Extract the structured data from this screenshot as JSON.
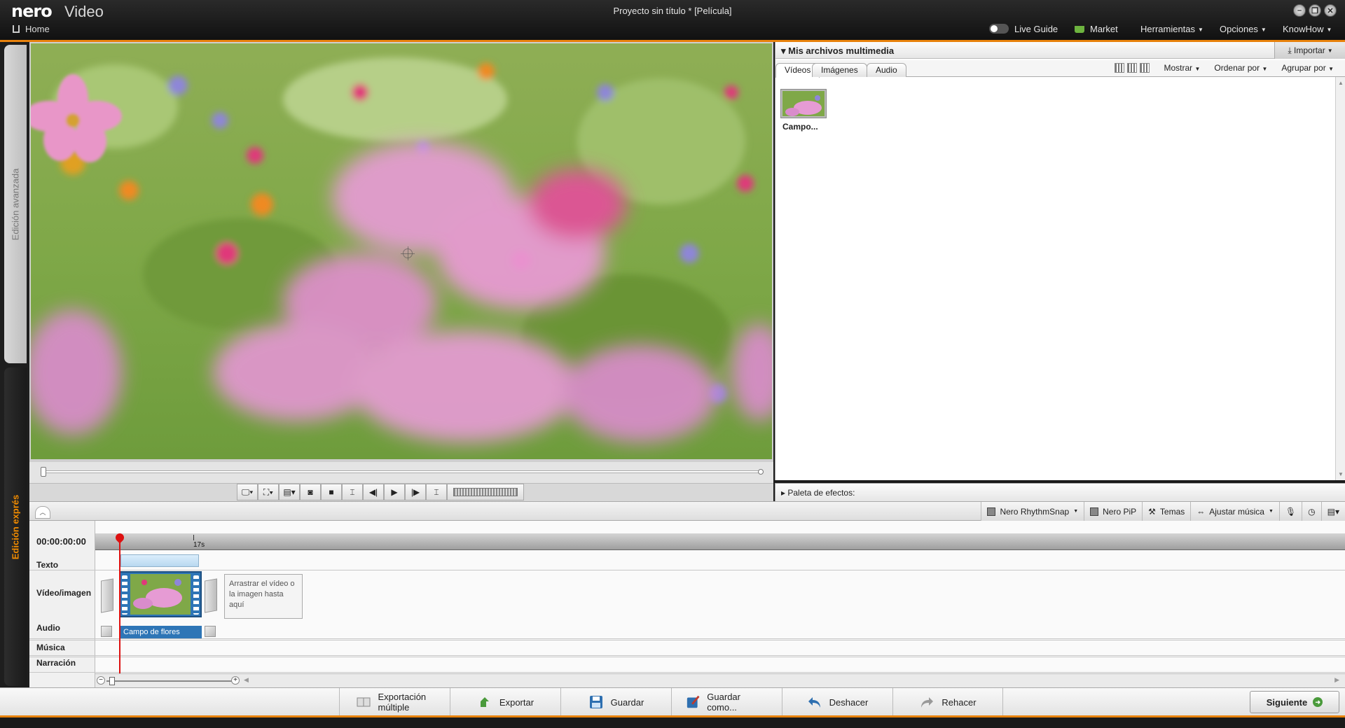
{
  "app": {
    "logo": "nero",
    "logo_product": "Video",
    "window_title": "Proyecto sin título * [Película]",
    "home_label": "Home",
    "accent_color": "#e8820c"
  },
  "top_menu": {
    "live_guide": "Live Guide",
    "market": "Market",
    "herramientas": "Herramientas",
    "opciones": "Opciones",
    "knowhow": "KnowHow"
  },
  "side_tabs": {
    "advanced": "Edición avanzada",
    "express": "Edición exprés"
  },
  "media_panel": {
    "title": "Mis archivos multimedia",
    "import": "Importar",
    "tabs": [
      "Vídeos",
      "Imágenes",
      "Audio"
    ],
    "mostrar": "Mostrar",
    "ordenar": "Ordenar por",
    "agrupar": "Agrupar por",
    "item_label": "Campo..."
  },
  "effects_panel": {
    "title": "Paleta de efectos:"
  },
  "timeline_toolbar": {
    "rhythmsnap": "Nero RhythmSnap",
    "pip": "Nero PiP",
    "temas": "Temas",
    "ajustar": "Ajustar música"
  },
  "timeline": {
    "timecode": "00:00:00:00",
    "tick": "17s",
    "tracks": [
      "Texto",
      "Vídeo/imagen",
      "Audio",
      "Música",
      "Narración"
    ],
    "clip_name": "Campo de flores",
    "drop_hint": "Arrastrar el vídeo o la imagen hasta aquí"
  },
  "bottom_bar": {
    "export_multi": "Exportación múltiple",
    "export": "Exportar",
    "save": "Guardar",
    "save_as": "Guardar como...",
    "undo": "Deshacer",
    "redo": "Rehacer",
    "next": "Siguiente"
  }
}
